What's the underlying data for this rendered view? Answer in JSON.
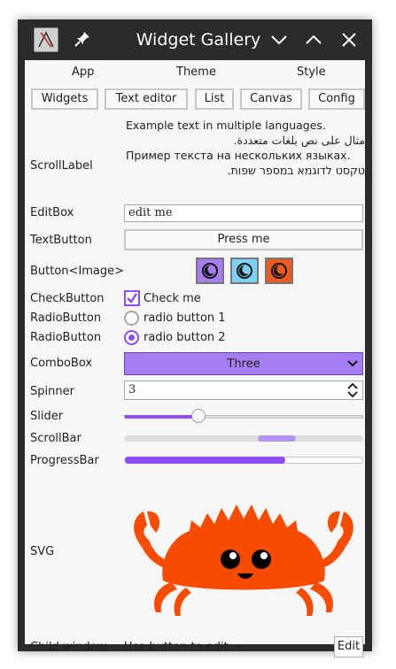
{
  "window": {
    "title": "Widget Gallery"
  },
  "menu": {
    "items": [
      "App",
      "Theme",
      "Style"
    ]
  },
  "tabs": [
    "Widgets",
    "Text editor",
    "List",
    "Canvas",
    "Config"
  ],
  "scroll_label": {
    "label": "ScrollLabel",
    "lines": [
      "Example text in multiple languages.",
      "مثال على نص بلغات متعددة.",
      "Пример текста на нескольких языках.",
      "טקסט לדוגמא במספר שפות."
    ]
  },
  "editbox": {
    "label": "EditBox",
    "value": "edit me"
  },
  "textbutton": {
    "label": "TextButton",
    "text": "Press me"
  },
  "image_buttons": {
    "label": "Button<Image>",
    "colors": [
      "#a77ef2",
      "#7cd2f8",
      "#f15a1f"
    ]
  },
  "checkbutton": {
    "label": "CheckButton",
    "text": "Check me",
    "checked": true
  },
  "radio1": {
    "label": "RadioButton",
    "text": "radio button 1",
    "checked": false
  },
  "radio2": {
    "label": "RadioButton",
    "text": "radio button 2",
    "checked": true
  },
  "combobox": {
    "label": "ComboBox",
    "selected": "Three"
  },
  "spinner": {
    "label": "Spinner",
    "value": "3"
  },
  "slider": {
    "label": "Slider",
    "value_fraction": 0.31
  },
  "scrollbar": {
    "label": "ScrollBar",
    "position_fraction": 0.56,
    "size_fraction": 0.16
  },
  "progressbar": {
    "label": "ProgressBar",
    "value_fraction": 0.67
  },
  "svg": {
    "label": "SVG"
  },
  "child_window": {
    "label": "Child window",
    "text": "Use button to edit →",
    "button": "Edit"
  },
  "colors": {
    "accent": "#8a4ff0",
    "accent_fill": "#a77ef2",
    "crab": "#f74c00",
    "titlebar": "#2b2b2b"
  }
}
